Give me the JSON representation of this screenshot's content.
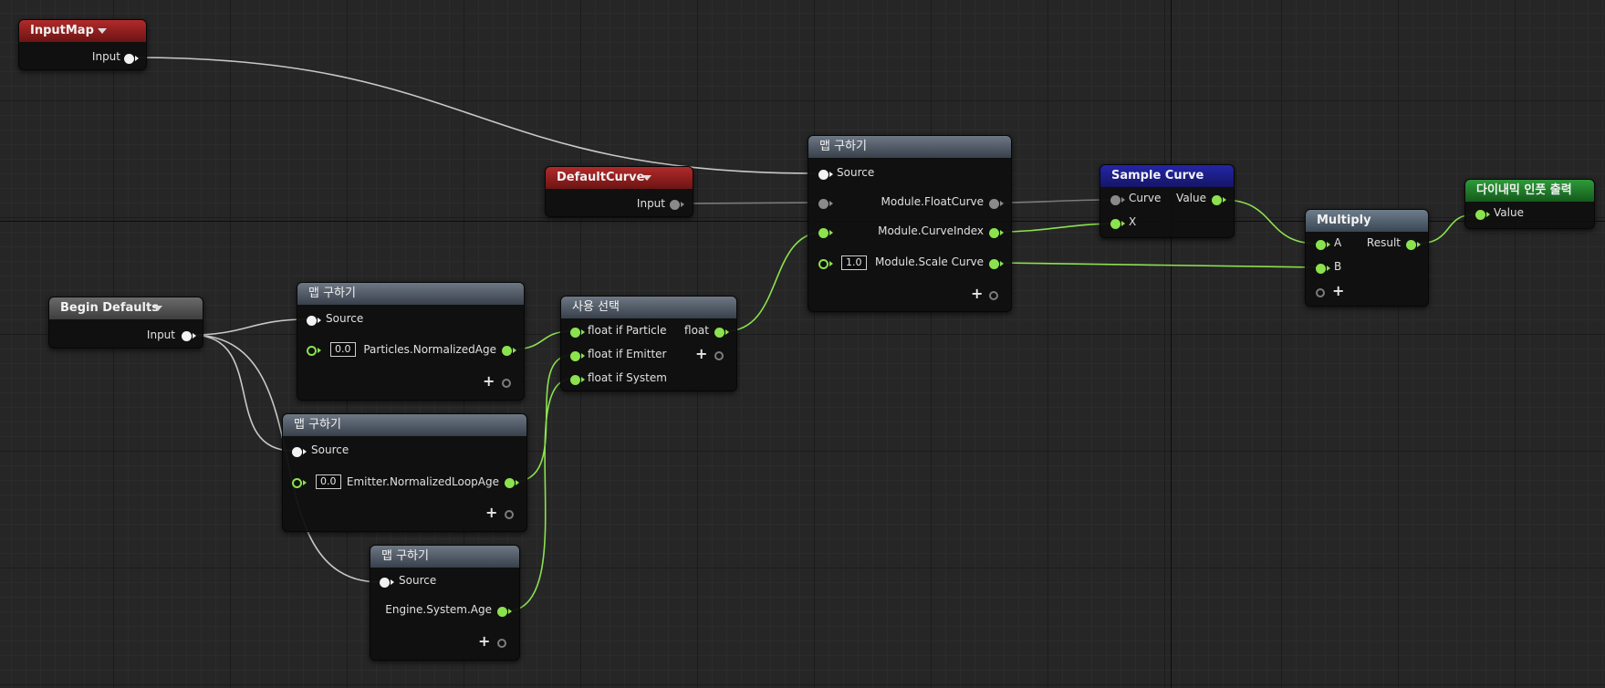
{
  "graph": {
    "nodes": {
      "input_map": {
        "title": "InputMap",
        "pin_input": "Input"
      },
      "default_curve": {
        "title": "DefaultCurve",
        "pin_input": "Input"
      },
      "begin_defaults": {
        "title": "Begin Defaults",
        "pin_input": "Input"
      },
      "map_get_main": {
        "title": "맵 구하기",
        "source": "Source",
        "float_curve": "Module.FloatCurve",
        "curve_index": "Module.CurveIndex",
        "scale_default": "1.0",
        "scale_curve": "Module.Scale Curve"
      },
      "map_get_particles": {
        "title": "맵 구하기",
        "source": "Source",
        "default": "0.0",
        "output": "Particles.NormalizedAge"
      },
      "map_get_emitter": {
        "title": "맵 구하기",
        "source": "Source",
        "default": "0.0",
        "output": "Emitter.NormalizedLoopAge"
      },
      "map_get_engine": {
        "title": "맵 구하기",
        "source": "Source",
        "output": "Engine.System.Age"
      },
      "select_usage": {
        "title": "사용 선택",
        "in_particle": "float if Particle",
        "in_emitter": "float if Emitter",
        "in_system": "float if System",
        "output": "float"
      },
      "sample_curve": {
        "title": "Sample Curve",
        "in_curve": "Curve",
        "in_x": "X",
        "output": "Value"
      },
      "multiply": {
        "title": "Multiply",
        "in_a": "A",
        "in_b": "B",
        "output": "Result"
      },
      "dynamic_input_output": {
        "title": "다이내믹 인풋 출력",
        "in_value": "Value"
      }
    }
  },
  "colors": {
    "float_pin": "#8be24e",
    "param_pin": "#f2f2f2",
    "curve_pin": "#8a8a8a",
    "param_header": "#9c1f1f",
    "map_header": "#4d5763",
    "sample_curve_header": "#1c1e8a",
    "output_header": "#1f7a28"
  }
}
